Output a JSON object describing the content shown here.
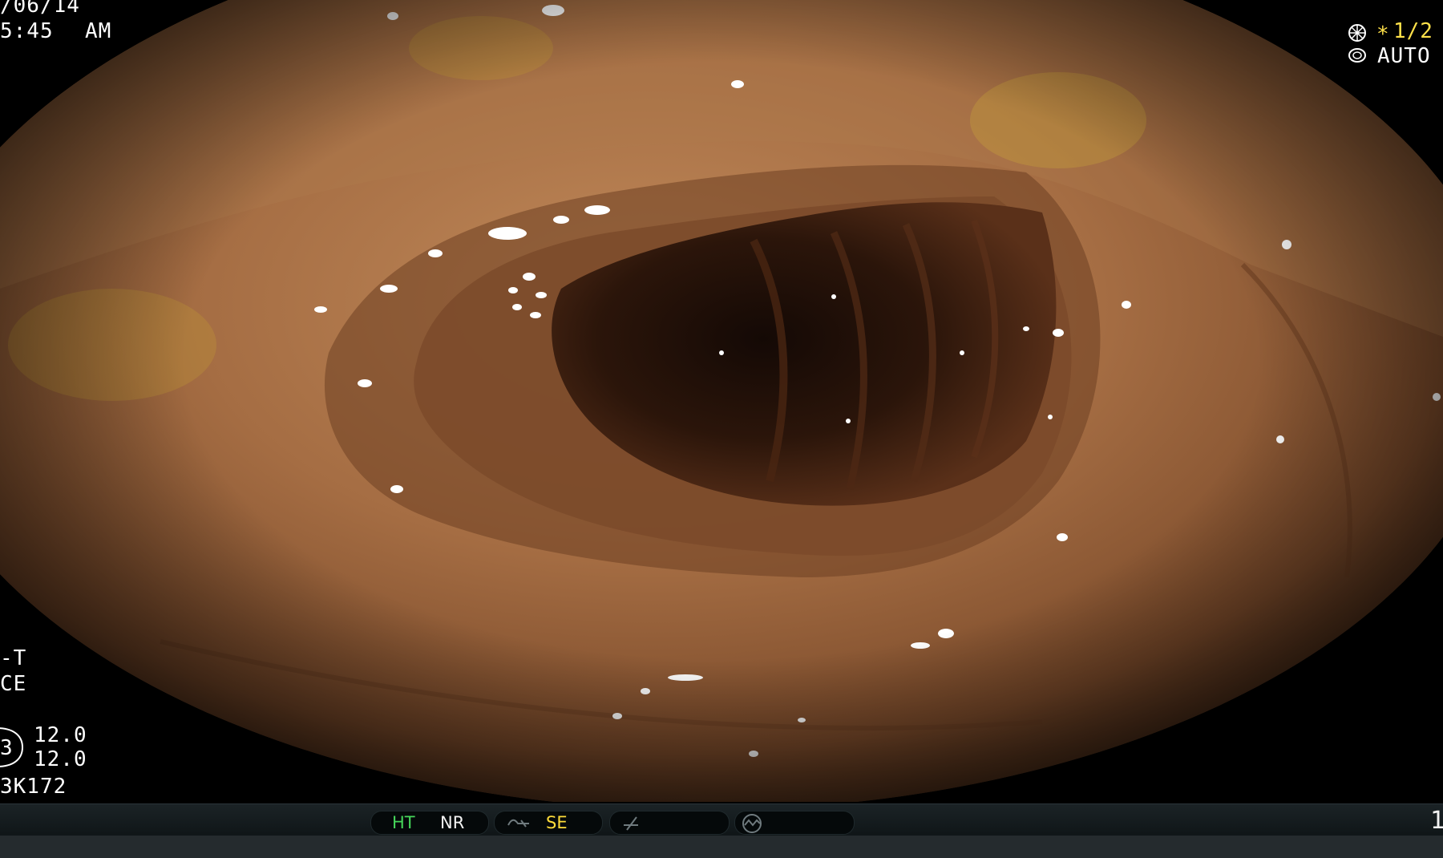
{
  "overlay": {
    "date": "/06/14",
    "time": "5:45",
    "meridiem": "AM",
    "shutter_value": "1/2",
    "shutter_marker": "*",
    "iris_mode": "AUTO",
    "mode_line1": "-T",
    "mode_line2": "CE",
    "gauge_letter": "3",
    "gauge_value_1": "12.0",
    "gauge_value_2": "12.0",
    "scope_id": "3K172",
    "corner_digit": "1"
  },
  "status_bar": {
    "ht": "HT",
    "nr": "NR",
    "se": "SE"
  },
  "icons": {
    "shutter": "shutter-wheel-icon",
    "iris": "iris-ring-icon",
    "structure": "structure-enhance-icon",
    "color": "color-slash-icon",
    "exposure": "exposure-dial-icon"
  },
  "colors": {
    "ht": "#46d65a",
    "se": "#ffdc3a",
    "osd_yellow": "#ffe14a"
  }
}
